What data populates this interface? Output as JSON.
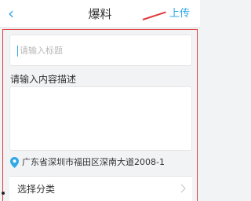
{
  "header": {
    "back_icon": "chevron-left-icon",
    "title": "爆料",
    "upload_label": "上传"
  },
  "form": {
    "title_placeholder": "请输入标题",
    "description_label": "请输入内容描述",
    "location_icon": "location-pin-icon",
    "location_text": "广东省深圳市福田区深南大道2008-1",
    "category_label": "选择分类",
    "category_icon": "chevron-right-icon"
  },
  "colors": {
    "accent": "#2fa8e8",
    "annotation": "#e03a3a",
    "background": "#f2f3f5"
  }
}
